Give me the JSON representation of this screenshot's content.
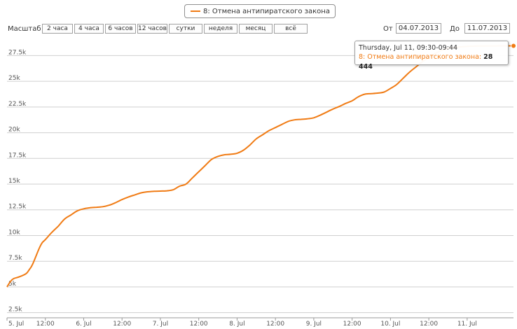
{
  "legend": {
    "series_name": "8: Отмена антипиратского закона"
  },
  "zoom": {
    "label": "Масштаб",
    "buttons": [
      "2 часа",
      "4 часа",
      "6 часов",
      "12 часов",
      "сутки",
      "неделя",
      "месяц",
      "всё"
    ]
  },
  "range": {
    "from_label": "От",
    "from_value": "04.07.2013",
    "to_label": "До",
    "to_value": "11.07.2013"
  },
  "tooltip": {
    "header": "Thursday, Jul 11, 09:30-09:44",
    "series": "8: Отмена антипиратского закона",
    "value": "28 444"
  },
  "colors": {
    "series": "#f07b14",
    "grid": "#cfcfcf",
    "axis": "#9a9a9a"
  },
  "chart_data": {
    "type": "line",
    "title": "",
    "xlabel": "",
    "ylabel": "",
    "x_tick_labels": [
      "5. Jul",
      "12:00",
      "6. Jul",
      "12:00",
      "7. Jul",
      "12:00",
      "8. Jul",
      "12:00",
      "9. Jul",
      "12:00",
      "10. Jul",
      "12:00",
      "11. Jul"
    ],
    "y_tick_labels": [
      "2.5k",
      "5k",
      "7.5k",
      "10k",
      "12.5k",
      "15k",
      "17.5k",
      "20k",
      "22.5k",
      "25k",
      "27.5k"
    ],
    "xlim_hours": [
      0,
      158.5
    ],
    "ylim": [
      2000,
      29500
    ],
    "grid": true,
    "legend": "top-center",
    "series": [
      {
        "name": "8: Отмена антипиратского закона",
        "x_hours": [
          0,
          1,
          2,
          4,
          6,
          7,
          8,
          10,
          11,
          12,
          14,
          16,
          18,
          20,
          22,
          24,
          26,
          28,
          30,
          32,
          34,
          36,
          38,
          40,
          42,
          44,
          46,
          48,
          50,
          52,
          54,
          56,
          58,
          60,
          62,
          64,
          66,
          68,
          70,
          72,
          74,
          76,
          78,
          80,
          82,
          84,
          86,
          88,
          90,
          92,
          94,
          96,
          98,
          100,
          102,
          104,
          106,
          108,
          110,
          112,
          114,
          116,
          118,
          120,
          122,
          124,
          126,
          128,
          130,
          132,
          134,
          136,
          138,
          140,
          142,
          144,
          146,
          148,
          150,
          152,
          154,
          156,
          158.5
        ],
        "values": [
          5000,
          5500,
          5800,
          6000,
          6300,
          6700,
          7200,
          8700,
          9300,
          9600,
          10300,
          10900,
          11600,
          12000,
          12400,
          12600,
          12700,
          12750,
          12800,
          12950,
          13200,
          13500,
          13750,
          13950,
          14150,
          14250,
          14300,
          14320,
          14350,
          14450,
          14800,
          15000,
          15600,
          16200,
          16800,
          17400,
          17700,
          17850,
          17900,
          18000,
          18300,
          18800,
          19400,
          19800,
          20200,
          20500,
          20800,
          21100,
          21250,
          21300,
          21350,
          21450,
          21700,
          22000,
          22300,
          22550,
          22850,
          23100,
          23500,
          23750,
          23800,
          23850,
          23950,
          24300,
          24700,
          25300,
          25900,
          26400,
          26900,
          27300,
          27700,
          28000,
          28200,
          28300,
          28350,
          28400,
          28420,
          28430,
          28435,
          28440,
          28442,
          28443,
          28444
        ]
      }
    ]
  }
}
